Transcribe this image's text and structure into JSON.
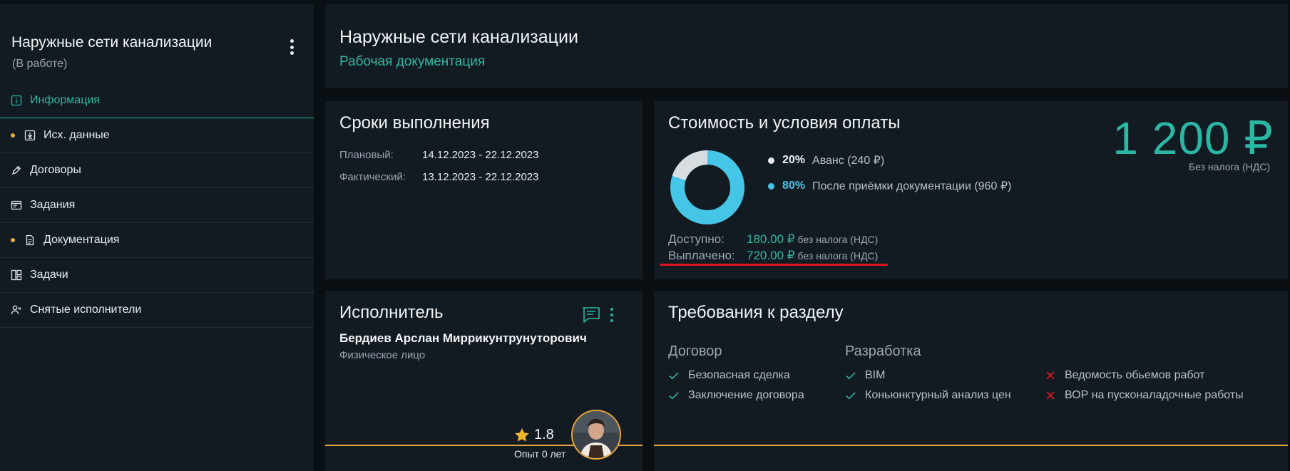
{
  "sidebar": {
    "title": "Наружные сети канализации",
    "status": "(В работе)",
    "items": [
      {
        "label": "Информация",
        "icon": "info-icon",
        "active": true,
        "dot": false
      },
      {
        "label": "Исх. данные",
        "icon": "download-icon",
        "active": false,
        "dot": true
      },
      {
        "label": "Договоры",
        "icon": "pen-icon",
        "active": false,
        "dot": false
      },
      {
        "label": "Задания",
        "icon": "task-window-icon",
        "active": false,
        "dot": false
      },
      {
        "label": "Документация",
        "icon": "document-icon",
        "active": false,
        "dot": true
      },
      {
        "label": "Задачи",
        "icon": "board-icon",
        "active": false,
        "dot": false
      },
      {
        "label": "Снятые исполнители",
        "icon": "user-remove-icon",
        "active": false,
        "dot": false
      }
    ]
  },
  "header": {
    "title": "Наружные сети канализации",
    "subtitle": "Рабочая документация"
  },
  "terms": {
    "title": "Сроки выполнения",
    "planned_label": "Плановый:",
    "planned_value": "14.12.2023 - 22.12.2023",
    "actual_label": "Фактический:",
    "actual_value": "13.12.2023 - 22.12.2023"
  },
  "cost": {
    "title": "Стоимость и условия оплаты",
    "price": "1 200 ₽",
    "price_note": "Без налога (НДС)",
    "advance_pct": "20%",
    "advance_desc": "Аванс (240 ₽)",
    "after_pct": "80%",
    "after_desc": "После приёмки документации (960 ₽)",
    "donut_fractions": [
      0.2,
      0.8
    ],
    "available_label": "Доступно:",
    "available_value": "180.00 ₽",
    "available_note": "без налога (НДС)",
    "paid_label": "Выплачено:",
    "paid_value": "720.00 ₽",
    "paid_note": "без налога (НДС)"
  },
  "executor": {
    "title": "Исполнитель",
    "name": "Бердиев Арслан Миррикунтрунуторович",
    "type": "Физическое лицо",
    "rating": "1.8",
    "experience": "Опыт 0 лет"
  },
  "requirements": {
    "title": "Требования к разделу",
    "contract_head": "Договор",
    "dev_head": "Разработка",
    "contract_items": [
      "Безопасная сделка",
      "Заключение договора"
    ],
    "dev_items": [
      "BIM",
      "Коньюнктурный анализ цен"
    ],
    "missing_items": [
      "Ведомость обьемов работ",
      "ВОР на пусконаладочные работы"
    ]
  },
  "colors": {
    "accent": "#2ab7a4",
    "donut_main": "#45c6e6",
    "donut_minor": "#d8dde2",
    "warning": "#e8a739",
    "error": "#e0141e"
  }
}
